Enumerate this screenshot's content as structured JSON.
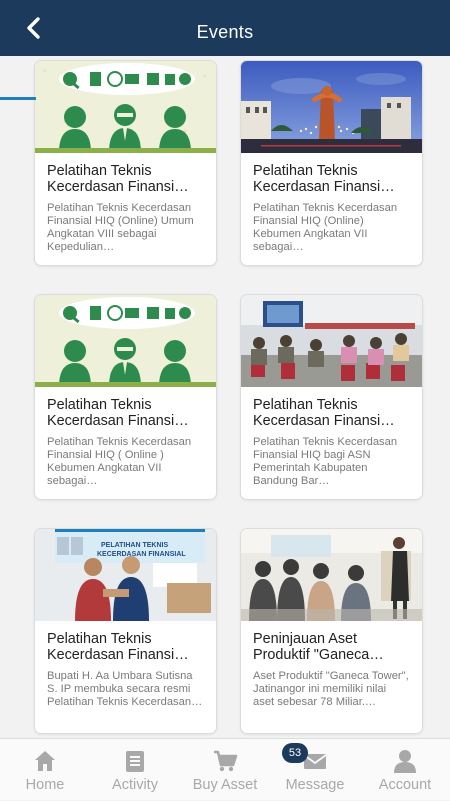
{
  "header": {
    "title": "Events",
    "back_icon": "back-arrow-icon"
  },
  "events": [
    {
      "title": "Pelatihan Teknis Kecerdasan Finansi…",
      "description": "Pelatihan Teknis Kecerdasan Finansial HIQ (Online) Umum Angkatan VIII sebagai Kepedulian…",
      "image": "finance-illustration"
    },
    {
      "title": "Pelatihan Teknis Kecerdasan Finansi…",
      "description": "Pelatihan Teknis Kecerdasan Finansial HIQ (Online) Kebumen Angkatan VII sebagai…",
      "image": "city-monument-photo"
    },
    {
      "title": "Pelatihan Teknis Kecerdasan Finansi…",
      "description": "Pelatihan Teknis Kecerdasan Finansial HIQ ( Online ) Kebumen Angkatan VII sebagai…",
      "image": "finance-illustration"
    },
    {
      "title": "Pelatihan Teknis Kecerdasan Finansi…",
      "description": "Pelatihan Teknis Kecerdasan Finansial HIQ bagi ASN Pemerintah Kabupaten Bandung Bar…",
      "image": "classroom-photo"
    },
    {
      "title": "Pelatihan Teknis Kecerdasan Finansi…",
      "description": "Bupati H. Aa Umbara Sutisna S. IP membuka secara resmi Pelatihan Teknis Kecerdasan…",
      "image": "handshake-photo",
      "banner_text": "PELATIHAN TEKNIS KECERDASAN FINANSIAL"
    },
    {
      "title": "Peninjauan Aset Produktif \"Ganeca…",
      "description": "Aset Produktif \"Ganeca Tower\", Jatinangor ini memiliki nilai aset sebesar 78 Miliar.…",
      "image": "meeting-room-photo"
    }
  ],
  "nav": [
    {
      "label": "Home",
      "icon": "home-icon"
    },
    {
      "label": "Activity",
      "icon": "document-icon"
    },
    {
      "label": "Buy Asset",
      "icon": "cart-icon"
    },
    {
      "label": "Message",
      "icon": "envelope-icon",
      "badge": "53"
    },
    {
      "label": "Account",
      "icon": "user-icon"
    }
  ],
  "colors": {
    "header": "#1b3a5c",
    "accent": "#1f7fb8",
    "illustration_green": "#2e8b4e",
    "nav_inactive": "#a8a8a8"
  }
}
